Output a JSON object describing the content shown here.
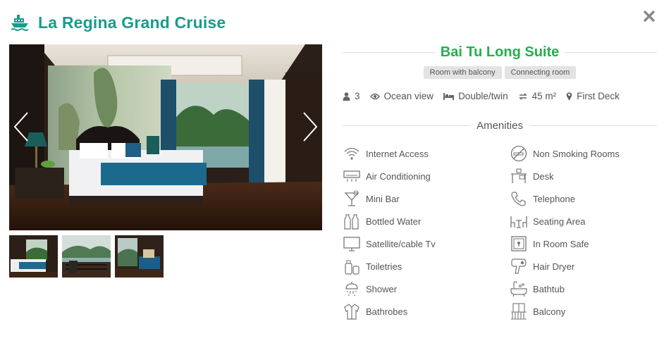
{
  "header": {
    "title": "La Regina Grand Cruise",
    "icon": "cruise-ship-icon"
  },
  "colors": {
    "brand_teal": "#1a9b8a",
    "room_green": "#21b04b",
    "tag_bg": "#e3e3e3"
  },
  "room": {
    "name": "Bai Tu Long Suite",
    "tags": [
      "Room with balcony",
      "Connecting room"
    ],
    "specs": {
      "guests": "3",
      "view": "Ocean view",
      "bed": "Double/twin",
      "size": "45 m²",
      "deck": "First Deck"
    }
  },
  "amenities_title": "Amenities",
  "amenities": {
    "left": [
      {
        "label": "Internet Access",
        "icon": "wifi-icon"
      },
      {
        "label": "Air Conditioning",
        "icon": "air-conditioner-icon"
      },
      {
        "label": "Mini Bar",
        "icon": "cocktail-icon"
      },
      {
        "label": "Bottled Water",
        "icon": "bottles-icon"
      },
      {
        "label": "Satellite/cable Tv",
        "icon": "tv-icon"
      },
      {
        "label": "Toiletries",
        "icon": "toiletries-icon"
      },
      {
        "label": "Shower",
        "icon": "shower-icon"
      },
      {
        "label": "Bathrobes",
        "icon": "bathrobe-icon"
      }
    ],
    "right": [
      {
        "label": "Non Smoking Rooms",
        "icon": "no-smoking-icon"
      },
      {
        "label": "Desk",
        "icon": "desk-icon"
      },
      {
        "label": "Telephone",
        "icon": "telephone-icon"
      },
      {
        "label": "Seating Area",
        "icon": "seating-icon"
      },
      {
        "label": "In Room Safe",
        "icon": "safe-icon"
      },
      {
        "label": "Hair Dryer",
        "icon": "hair-dryer-icon"
      },
      {
        "label": "Bathtub",
        "icon": "bathtub-icon"
      },
      {
        "label": "Balcony",
        "icon": "balcony-icon"
      }
    ]
  }
}
